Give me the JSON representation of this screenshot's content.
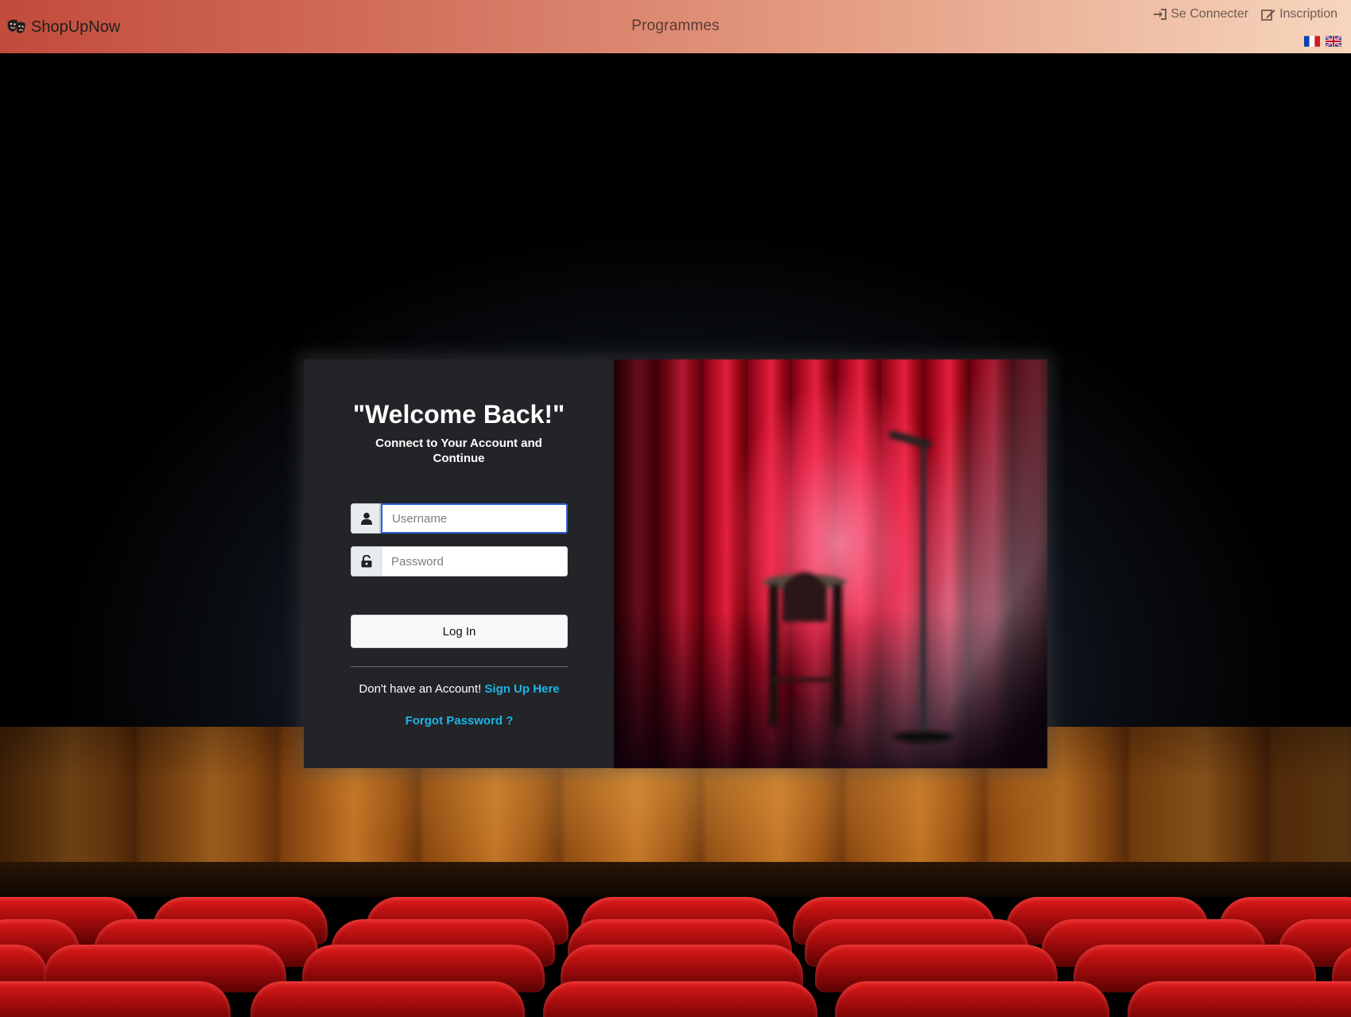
{
  "navbar": {
    "brand": "ShopUpNow",
    "center_link": "Programmes",
    "login_label": "Se Connecter",
    "signup_label": "Inscription",
    "languages": [
      "fr",
      "en"
    ]
  },
  "login": {
    "title": "\"Welcome Back!\"",
    "subtitle": "Connect to Your Account and Continue",
    "username_placeholder": "Username",
    "password_placeholder": "Password",
    "login_button": "Log In",
    "no_account_text": "Don't have an Account!",
    "signup_link": "Sign Up Here",
    "forgot_link": "Forgot Password ?"
  },
  "colors": {
    "accent_link": "#1cb6e6",
    "navbar_start": "#c24b3b",
    "navbar_end": "#f6d6bd"
  },
  "icons": {
    "brand": "theater-masks-icon",
    "login": "sign-in-icon",
    "signup": "edit-icon",
    "username": "user-icon",
    "password": "lock-icon"
  }
}
